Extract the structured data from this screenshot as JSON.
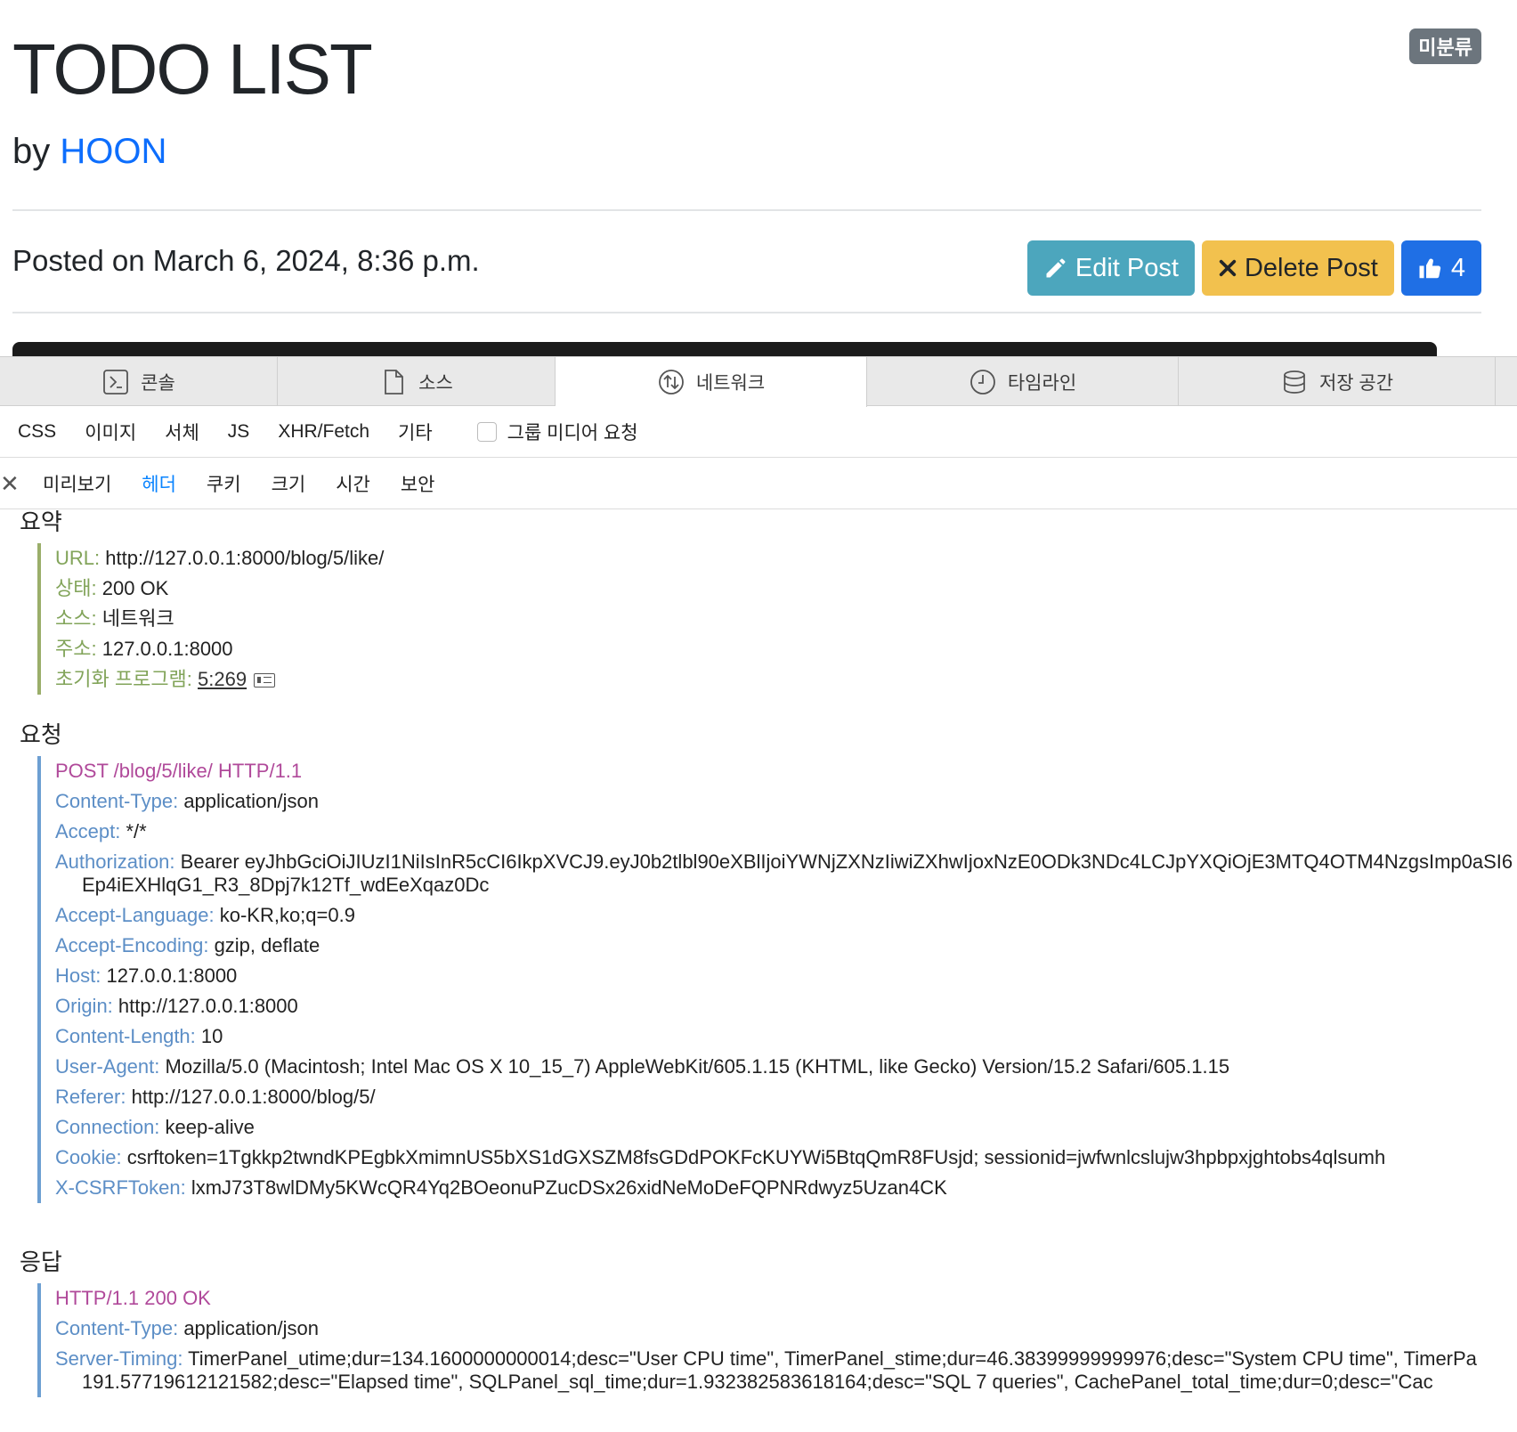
{
  "page": {
    "title": "TODO LIST",
    "by_prefix": "by",
    "author": "HOON",
    "category_badge": "미분류",
    "posted": "Posted on March 6, 2024, 8:36 p.m.",
    "edit_label": "Edit Post",
    "delete_label": "Delete Post",
    "like_count": "4"
  },
  "devtools": {
    "tabs": [
      {
        "label": "콘솔",
        "icon": "console-icon"
      },
      {
        "label": "소스",
        "icon": "document-icon"
      },
      {
        "label": "네트워크",
        "icon": "network-icon"
      },
      {
        "label": "타임라인",
        "icon": "clock-icon"
      },
      {
        "label": "저장 공간",
        "icon": "database-icon"
      }
    ],
    "filters": [
      "CSS",
      "이미지",
      "서체",
      "JS",
      "XHR/Fetch",
      "기타"
    ],
    "group_media_label": "그룹 미디어 요청",
    "subtabs": [
      "미리보기",
      "헤더",
      "쿠키",
      "크기",
      "시간",
      "보안"
    ],
    "active_subtab": "헤더",
    "summary": {
      "title": "요약",
      "rows": [
        {
          "key": "URL:",
          "value": "http://127.0.0.1:8000/blog/5/like/"
        },
        {
          "key": "상태:",
          "value": "200 OK"
        },
        {
          "key": "소스:",
          "value": "네트워크"
        },
        {
          "key": "주소:",
          "value": "127.0.0.1:8000"
        }
      ],
      "initiator_key": "초기화 프로그램:",
      "initiator_value": "5:269"
    },
    "request": {
      "title": "요청",
      "request_line": "POST /blog/5/like/ HTTP/1.1",
      "headers": [
        {
          "key": "Content-Type:",
          "value": "application/json"
        },
        {
          "key": "Accept:",
          "value": "*/*"
        },
        {
          "key": "Authorization:",
          "value": "Bearer eyJhbGciOiJIUzI1NiIsInR5cCI6IkpXVCJ9.eyJ0b2tlbl90eXBlIjoiYWNjZXNzIiwiZXhwIjoxNzE0ODk3NDc4LCJpYXQiOjE3MTQ4OTM4NzgsImp0aSI6",
          "cont": "Ep4iEXHlqG1_R3_8Dpj7k12Tf_wdEeXqaz0Dc"
        },
        {
          "key": "Accept-Language:",
          "value": "ko-KR,ko;q=0.9"
        },
        {
          "key": "Accept-Encoding:",
          "value": "gzip, deflate"
        },
        {
          "key": "Host:",
          "value": "127.0.0.1:8000"
        },
        {
          "key": "Origin:",
          "value": "http://127.0.0.1:8000"
        },
        {
          "key": "Content-Length:",
          "value": "10"
        },
        {
          "key": "User-Agent:",
          "value": "Mozilla/5.0 (Macintosh; Intel Mac OS X 10_15_7) AppleWebKit/605.1.15 (KHTML, like Gecko) Version/15.2 Safari/605.1.15"
        },
        {
          "key": "Referer:",
          "value": "http://127.0.0.1:8000/blog/5/"
        },
        {
          "key": "Connection:",
          "value": "keep-alive"
        },
        {
          "key": "Cookie:",
          "value": "csrftoken=1Tgkkp2twndKPEgbkXmimnUS5bXS1dGXSZM8fsGDdPOKFcKUYWi5BtqQmR8FUsjd; sessionid=jwfwnlcslujw3hpbpxjghtobs4qlsumh"
        },
        {
          "key": "X-CSRFToken:",
          "value": "lxmJ73T8wlDMy5KWcQR4Yq2BOeonuPZucDSx26xidNeMoDeFQPNRdwyz5Uzan4CK"
        }
      ]
    },
    "response": {
      "title": "응답",
      "status_line": "HTTP/1.1 200 OK",
      "headers": [
        {
          "key": "Content-Type:",
          "value": "application/json"
        },
        {
          "key": "Server-Timing:",
          "value": "TimerPanel_utime;dur=134.1600000000014;desc=\"User CPU time\", TimerPanel_stime;dur=46.38399999999976;desc=\"System CPU time\", TimerPa",
          "cont": "191.57719612121582;desc=\"Elapsed time\", SQLPanel_sql_time;dur=1.932382583618164;desc=\"SQL 7 queries\", CachePanel_total_time;dur=0;desc=\"Cac"
        }
      ]
    }
  }
}
